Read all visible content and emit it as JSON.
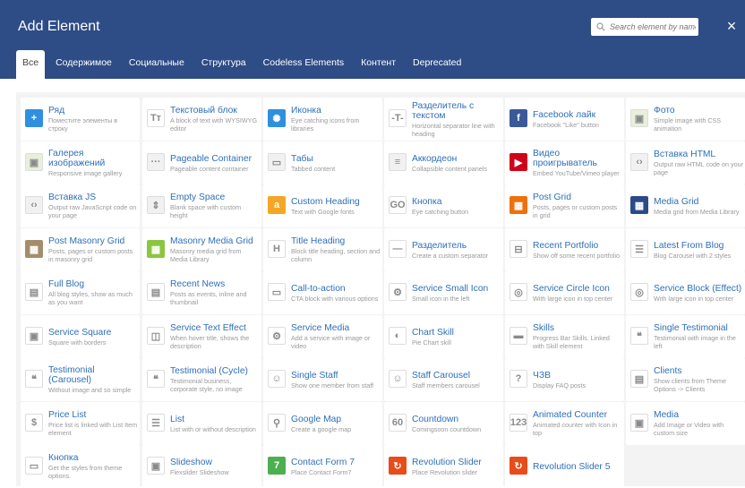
{
  "header": {
    "title": "Add Element",
    "search_placeholder": "Search element by name",
    "close_label": "×"
  },
  "tabs": [
    {
      "label": "Все",
      "active": true
    },
    {
      "label": "Содержимое",
      "active": false
    },
    {
      "label": "Социальные",
      "active": false
    },
    {
      "label": "Структура",
      "active": false
    },
    {
      "label": "Codeless Elements",
      "active": false
    },
    {
      "label": "Контент",
      "active": false
    },
    {
      "label": "Deprecated",
      "active": false
    }
  ],
  "elements": [
    {
      "name": "Ряд",
      "desc": "Поместите элементы в строку",
      "icon": "row-icon",
      "color": "#2f8fe0",
      "glyph": "+"
    },
    {
      "name": "Текстовый блок",
      "desc": "A block of text with WYSIWYG editor",
      "icon": "text-block-icon",
      "color": "#ffffff",
      "glyph": "Tт"
    },
    {
      "name": "Иконка",
      "desc": "Eye catching icons from libraries",
      "icon": "icon-element-icon",
      "color": "#2f8fe0",
      "glyph": "✺"
    },
    {
      "name": "Разделитель с текстом",
      "desc": "Horizontal separator line with heading",
      "icon": "text-separator-icon",
      "color": "#ffffff",
      "glyph": "-T-"
    },
    {
      "name": "Facebook лайк",
      "desc": "Facebook \"Like\" button",
      "icon": "facebook-icon",
      "color": "#3b5998",
      "glyph": "f"
    },
    {
      "name": "Фото",
      "desc": "Simple image with CSS animation",
      "icon": "image-icon",
      "color": "#e8efdc",
      "glyph": "▣"
    },
    {
      "name": "Галерея изображений",
      "desc": "Responsive image gallery",
      "icon": "gallery-icon",
      "color": "#e8efdc",
      "glyph": "▣"
    },
    {
      "name": "Pageable Container",
      "desc": "Pageable content container",
      "icon": "pageable-container-icon",
      "color": "#f1f1f1",
      "glyph": "···"
    },
    {
      "name": "Табы",
      "desc": "Tabbed content",
      "icon": "tabs-icon",
      "color": "#f1f1f1",
      "glyph": "▭"
    },
    {
      "name": "Аккордеон",
      "desc": "Collapsible content panels",
      "icon": "accordion-icon",
      "color": "#f1f1f1",
      "glyph": "≡"
    },
    {
      "name": "Видео проигрыватель",
      "desc": "Embed YouTube/Vimeo player",
      "icon": "video-player-icon",
      "color": "#d0021b",
      "glyph": "▶"
    },
    {
      "name": "Вставка HTML",
      "desc": "Output raw HTML code on your page",
      "icon": "raw-html-icon",
      "color": "#f1f1f1",
      "glyph": "‹›"
    },
    {
      "name": "Вставка JS",
      "desc": "Output raw JavaScript code on your page",
      "icon": "raw-js-icon",
      "color": "#f1f1f1",
      "glyph": "‹›"
    },
    {
      "name": "Empty Space",
      "desc": "Blank space with custom height",
      "icon": "empty-space-icon",
      "color": "#f1f1f1",
      "glyph": "⇕"
    },
    {
      "name": "Custom Heading",
      "desc": "Text with Google fonts",
      "icon": "custom-heading-icon",
      "color": "#f5a623",
      "glyph": "a"
    },
    {
      "name": "Кнопка",
      "desc": "Eye catching button",
      "icon": "button-icon",
      "color": "#ffffff",
      "glyph": "GO"
    },
    {
      "name": "Post Grid",
      "desc": "Posts, pages or custom posts in grid",
      "icon": "post-grid-icon",
      "color": "#f0700a",
      "glyph": "▦"
    },
    {
      "name": "Media Grid",
      "desc": "Media grid from Media Library",
      "icon": "media-grid-icon",
      "color": "#2c4a8a",
      "glyph": "▦"
    },
    {
      "name": "Post Masonry Grid",
      "desc": "Posts, pages or custom posts in masonry grid",
      "icon": "post-masonry-grid-icon",
      "color": "#a48d6a",
      "glyph": "▦"
    },
    {
      "name": "Masonry Media Grid",
      "desc": "Masonry media grid from Media Library",
      "icon": "masonry-media-grid-icon",
      "color": "#8cc63f",
      "glyph": "▦"
    },
    {
      "name": "Title Heading",
      "desc": "Block title heading, section and column",
      "icon": "title-heading-icon",
      "color": "#ffffff",
      "glyph": "H"
    },
    {
      "name": "Разделитель",
      "desc": "Create a custom separator",
      "icon": "separator-icon",
      "color": "#ffffff",
      "glyph": "—"
    },
    {
      "name": "Recent Portfolio",
      "desc": "Show off some recent portfolio",
      "icon": "recent-portfolio-icon",
      "color": "#ffffff",
      "glyph": "⊟"
    },
    {
      "name": "Latest From Blog",
      "desc": "Blog Carousel with 2 styles",
      "icon": "latest-blog-icon",
      "color": "#ffffff",
      "glyph": "☰"
    },
    {
      "name": "Full Blog",
      "desc": "All blog styles, show as much as you want",
      "icon": "full-blog-icon",
      "color": "#ffffff",
      "glyph": "▤"
    },
    {
      "name": "Recent News",
      "desc": "Posts as events, inline and thumbnail",
      "icon": "recent-news-icon",
      "color": "#ffffff",
      "glyph": "▤"
    },
    {
      "name": "Call-to-action",
      "desc": "CTA block with various options",
      "icon": "call-to-action-icon",
      "color": "#ffffff",
      "glyph": "▭"
    },
    {
      "name": "Service Small Icon",
      "desc": "Small icon in the left",
      "icon": "service-small-icon-icon",
      "color": "#ffffff",
      "glyph": "⚙"
    },
    {
      "name": "Service Circle Icon",
      "desc": "With large icon in top center",
      "icon": "service-circle-icon-icon",
      "color": "#ffffff",
      "glyph": "◎"
    },
    {
      "name": "Service Block (Effect)",
      "desc": "With large icon in top center",
      "icon": "service-block-icon",
      "color": "#ffffff",
      "glyph": "◎"
    },
    {
      "name": "Service Square",
      "desc": "Square with borders",
      "icon": "service-square-icon",
      "color": "#ffffff",
      "glyph": "▣"
    },
    {
      "name": "Service Text Effect",
      "desc": "When hover title, shows the description",
      "icon": "service-text-effect-icon",
      "color": "#ffffff",
      "glyph": "◫"
    },
    {
      "name": "Service Media",
      "desc": "Add a service with image or video",
      "icon": "service-media-icon",
      "color": "#ffffff",
      "glyph": "⚙"
    },
    {
      "name": "Chart Skill",
      "desc": "Pie Chart skill",
      "icon": "chart-skill-icon",
      "color": "#ffffff",
      "glyph": "◐"
    },
    {
      "name": "Skills",
      "desc": "Progress Bar Skills. Linked with Skill element",
      "icon": "skills-icon",
      "color": "#ffffff",
      "glyph": "▬"
    },
    {
      "name": "Single Testimonial",
      "desc": "Testimonial with image in the left",
      "icon": "single-testimonial-icon",
      "color": "#ffffff",
      "glyph": "❝"
    },
    {
      "name": "Testimonial (Carousel)",
      "desc": "Without image and so simple",
      "icon": "testimonial-carousel-icon",
      "color": "#ffffff",
      "glyph": "❝"
    },
    {
      "name": "Testimonial (Cycle)",
      "desc": "Testimonial business, corporate style, no image",
      "icon": "testimonial-cycle-icon",
      "color": "#ffffff",
      "glyph": "❝"
    },
    {
      "name": "Single Staff",
      "desc": "Show one member from staff",
      "icon": "single-staff-icon",
      "color": "#ffffff",
      "glyph": "☺"
    },
    {
      "name": "Staff Carousel",
      "desc": "Staff members carousel",
      "icon": "staff-carousel-icon",
      "color": "#ffffff",
      "glyph": "☺"
    },
    {
      "name": "ЧЗВ",
      "desc": "Display FAQ posts",
      "icon": "faq-icon",
      "color": "#ffffff",
      "glyph": "?"
    },
    {
      "name": "Clients",
      "desc": "Show clients from Theme Options -> Clients",
      "icon": "clients-icon",
      "color": "#ffffff",
      "glyph": "▤"
    },
    {
      "name": "Price List",
      "desc": "Price list is linked with List Item element",
      "icon": "price-list-icon",
      "color": "#ffffff",
      "glyph": "$"
    },
    {
      "name": "List",
      "desc": "List with or without description",
      "icon": "list-icon",
      "color": "#ffffff",
      "glyph": "☰"
    },
    {
      "name": "Google Map",
      "desc": "Create a google map",
      "icon": "google-map-icon",
      "color": "#ffffff",
      "glyph": "⚲"
    },
    {
      "name": "Countdown",
      "desc": "Comingsoon countdown",
      "icon": "countdown-icon",
      "color": "#ffffff",
      "glyph": "60"
    },
    {
      "name": "Animated Counter",
      "desc": "Animated counter with Icon in top",
      "icon": "animated-counter-icon",
      "color": "#ffffff",
      "glyph": "123"
    },
    {
      "name": "Media",
      "desc": "Add Image or Video with custom size",
      "icon": "media-icon",
      "color": "#ffffff",
      "glyph": "▣"
    },
    {
      "name": "Кнопка",
      "desc": "Get the styles from theme options.",
      "icon": "theme-button-icon",
      "color": "#ffffff",
      "glyph": "▭"
    },
    {
      "name": "Slideshow",
      "desc": "Flexslider Slideshow",
      "icon": "slideshow-icon",
      "color": "#ffffff",
      "glyph": "▣"
    },
    {
      "name": "Contact Form 7",
      "desc": "Place Contact Form7",
      "icon": "contact-form-7-icon",
      "color": "#4caf50",
      "glyph": "7"
    },
    {
      "name": "Revolution Slider",
      "desc": "Place Revolution slider",
      "icon": "revolution-slider-icon",
      "color": "#e74c1a",
      "glyph": "↻"
    },
    {
      "name": "Revolution Slider 5",
      "desc": "",
      "icon": "revolution-slider-5-icon",
      "color": "#e74c1a",
      "glyph": "↻"
    }
  ]
}
